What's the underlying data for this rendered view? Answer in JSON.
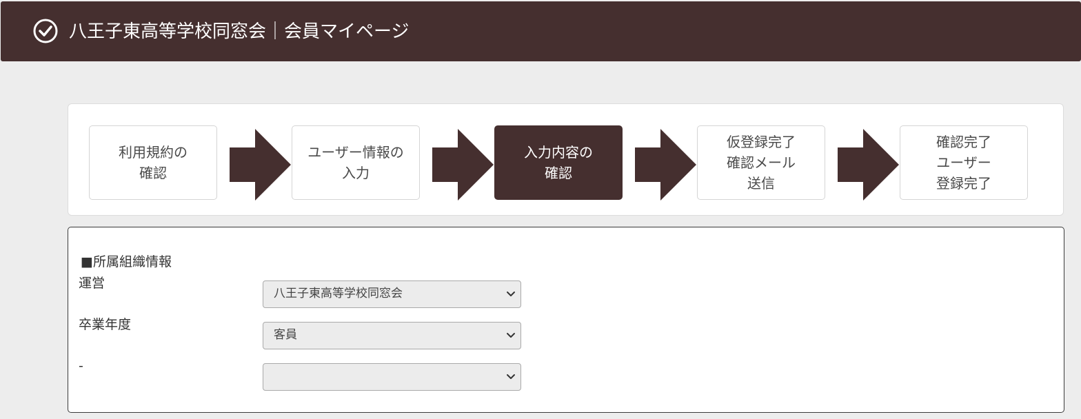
{
  "header": {
    "title": "八王子東高等学校同窓会｜会員マイページ",
    "logo_icon": "check-circle-icon",
    "background": "#452f2f"
  },
  "steps": [
    {
      "label": "利用規約の\n確認",
      "active": false
    },
    {
      "label": "ユーザー情報の\n入力",
      "active": false
    },
    {
      "label": "入力内容の\n確認",
      "active": true
    },
    {
      "label": "仮登録完了\n確認メール\n送信",
      "active": false
    },
    {
      "label": "確認完了\nユーザー\n登録完了",
      "active": false
    }
  ],
  "form": {
    "section_title": "■所属組織情報",
    "fields": [
      {
        "label": "運営",
        "value": "八王子東高等学校同窓会"
      },
      {
        "label": "卒業年度",
        "value": "客員"
      },
      {
        "label": "-",
        "value": ""
      }
    ]
  },
  "colors": {
    "accent": "#452f2f",
    "page_bg": "#ededed"
  }
}
